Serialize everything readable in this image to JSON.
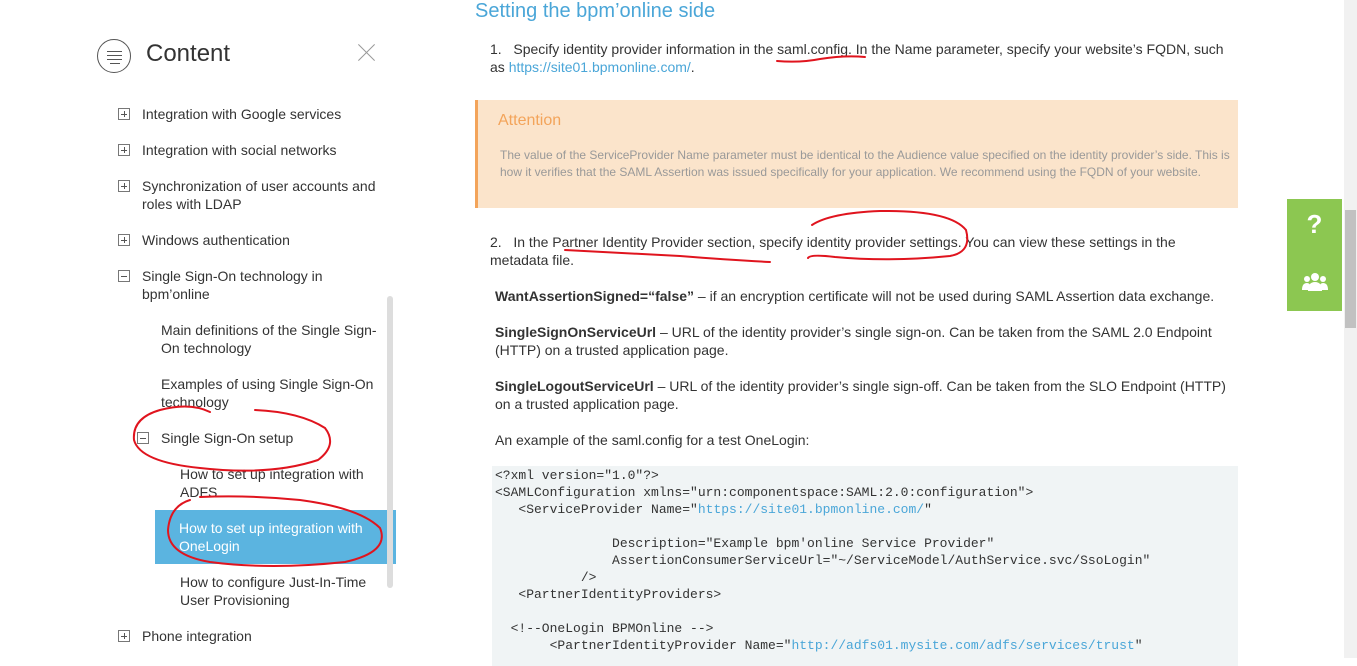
{
  "sidebar": {
    "title": "Content",
    "items": [
      {
        "label": "Integration with Google services",
        "toggle": "plus"
      },
      {
        "label": "Integration with social networks",
        "toggle": "plus"
      },
      {
        "label": "Synchronization of user accounts and roles with LDAP",
        "toggle": "plus"
      },
      {
        "label": "Windows authentication",
        "toggle": "plus"
      },
      {
        "label": "Single Sign-On technology in bpm’online",
        "toggle": "minus"
      },
      {
        "label": "Main definitions of the Single Sign-On technology"
      },
      {
        "label": "Examples of using Single Sign-On technology"
      },
      {
        "label": "Single Sign-On setup",
        "toggle": "minus"
      },
      {
        "label": "How to set up integration with ADFS"
      },
      {
        "label": "How to set up integration with OneLogin",
        "active": true
      },
      {
        "label": "How to configure Just-In-Time User Provisioning"
      },
      {
        "label": "Phone integration",
        "toggle": "plus"
      }
    ]
  },
  "main": {
    "heading": "Setting the bpm’online side",
    "step1": {
      "num": "1.",
      "text_a": "Specify identity provider information in the ",
      "highlight": "saml.config",
      "text_b": ". In the Name parameter, specify your website’s FQDN, such as ",
      "link": "https://site01.bpmonline.com/",
      "end": "."
    },
    "attention": {
      "title": "Attention",
      "text": "The value of the ServiceProvider Name parameter must be identical to the Audience value specified on the identity provider’s side. This is how it verifies that the SAML Assertion was issued specifically for your application. We recommend using the FQDN of your website."
    },
    "step2": {
      "num": "2.",
      "text": "In the Partner Identity Provider section, specify identity provider settings. You can view these settings in the metadata file."
    },
    "params": [
      {
        "name": "WantAssertionSigned=“false”",
        "desc": " – if an encryption certificate will not be used during SAML Assertion data exchange."
      },
      {
        "name": "SingleSignOnServiceUrl",
        "desc": " – URL of the identity provider’s single sign-on. Can be taken from the SAML 2.0 Endpoint (HTTP) on a trusted application page."
      },
      {
        "name": "SingleLogoutServiceUrl",
        "desc": " – URL of the identity provider’s single sign-off. Can be taken from the SLO Endpoint (HTTP) on a trusted application page."
      }
    ],
    "example_intro": "An example of the saml.config for a test OneLogin:",
    "code": {
      "l1": "<?xml version=\"1.0\"?>",
      "l2": "<SAMLConfiguration xmlns=\"urn:componentspace:SAML:2.0:configuration\">",
      "l3a": "   <ServiceProvider Name=\"",
      "l3v": "https://site01.bpmonline.com/",
      "l3b": "\"",
      "l4": "               Description=\"Example bpm'online Service Provider\"",
      "l5": "               AssertionConsumerServiceUrl=\"~/ServiceModel/AuthService.svc/SsoLogin\"",
      "l6": "           />",
      "l7": "   <PartnerIdentityProviders>",
      "l8": "  <!--OneLogin BPMOnline -->",
      "l9a": "       <PartnerIdentityProvider Name=\"",
      "l9v": "http://adfs01.mysite.com/adfs/services/trust",
      "l9b": "\""
    }
  },
  "help": {
    "question": "?",
    "community_icon": "people-icon"
  },
  "colors": {
    "accent": "#4aa6d8",
    "active_nav": "#5bb4e0",
    "attention_bg": "#fbe4cb",
    "attention_border": "#f3a45a",
    "help_green": "#8cc751",
    "annotation_red": "#e0141e"
  }
}
